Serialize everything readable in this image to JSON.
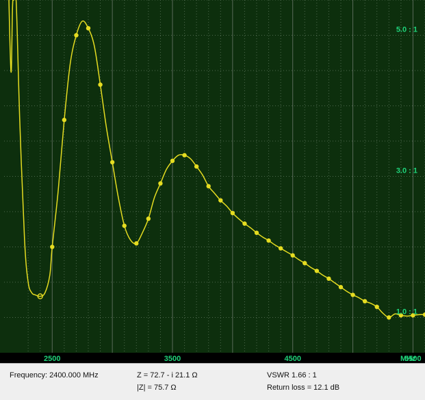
{
  "chart_data": {
    "type": "line",
    "xunit": "MHz",
    "xlim": [
      2100,
      5600
    ],
    "ylim": [
      0.5,
      5.5
    ],
    "x_ticks": [
      "2500",
      "3500",
      "4500",
      "5500"
    ],
    "x_tick_values": [
      2500,
      3500,
      4500,
      5500
    ],
    "y_ticks": [
      "5.0 : 1",
      "3.0 : 1",
      "1.0 : 1"
    ],
    "y_tick_values": [
      5.0,
      3.0,
      1.0
    ],
    "series": [
      {
        "color": "#e5dc21",
        "x": [
          2140,
          2150,
          2160,
          2170,
          2180,
          2200,
          2230,
          2270,
          2300,
          2330,
          2360,
          2400,
          2440,
          2480,
          2500,
          2550,
          2600,
          2650,
          2700,
          2750,
          2800,
          2850,
          2900,
          2950,
          3000,
          3050,
          3100,
          3150,
          3200,
          3250,
          3300,
          3350,
          3400,
          3450,
          3500,
          3550,
          3600,
          3650,
          3700,
          3750,
          3800,
          3850,
          3900,
          3950,
          4000,
          4050,
          4100,
          4150,
          4200,
          4250,
          4300,
          4350,
          4400,
          4450,
          4500,
          4550,
          4600,
          4650,
          4700,
          4750,
          4800,
          4850,
          4900,
          4950,
          5000,
          5050,
          5100,
          5150,
          5200,
          5250,
          5300,
          5350,
          5400,
          5450,
          5500,
          5550,
          5600
        ],
        "values": [
          5.5,
          4.8,
          4.5,
          5.4,
          5.5,
          5.5,
          3.8,
          2.1,
          1.5,
          1.35,
          1.32,
          1.3,
          1.35,
          1.6,
          2.0,
          2.8,
          3.8,
          4.6,
          5.0,
          5.2,
          5.1,
          4.85,
          4.3,
          3.7,
          3.2,
          2.7,
          2.3,
          2.1,
          2.05,
          2.2,
          2.4,
          2.7,
          2.9,
          3.1,
          3.22,
          3.3,
          3.3,
          3.25,
          3.14,
          3.02,
          2.86,
          2.76,
          2.66,
          2.58,
          2.48,
          2.4,
          2.33,
          2.27,
          2.2,
          2.14,
          2.09,
          2.03,
          1.98,
          1.93,
          1.88,
          1.82,
          1.77,
          1.71,
          1.66,
          1.6,
          1.55,
          1.49,
          1.43,
          1.37,
          1.32,
          1.28,
          1.23,
          1.2,
          1.15,
          1.06,
          1.0,
          1.05,
          1.03,
          1.02,
          1.03,
          1.04,
          1.04
        ],
        "markers_x": [
          2400,
          2500,
          2600,
          2700,
          2800,
          2900,
          3000,
          3100,
          3200,
          3300,
          3400,
          3500,
          3600,
          3700,
          3800,
          3900,
          4000,
          4100,
          4200,
          4300,
          4400,
          4500,
          4600,
          4700,
          4800,
          4900,
          5000,
          5100,
          5200,
          5300,
          5400,
          5500,
          5600
        ],
        "selected_x": 2400
      }
    ],
    "grid": true,
    "legend": "none"
  },
  "readout": {
    "frequency": "Frequency: 2400.000 MHz",
    "impedance": "Z = 72.7 - i 21.1 Ω",
    "magnitude": "|Z| = 75.7 Ω",
    "vswr": "VSWR 1.66 : 1",
    "return_loss": "Return loss = 12.1 dB"
  }
}
